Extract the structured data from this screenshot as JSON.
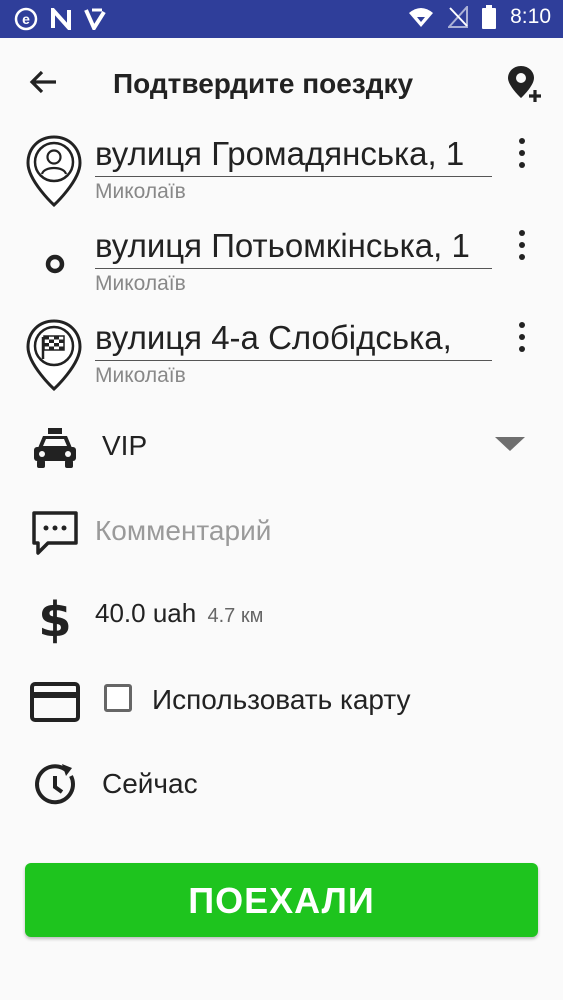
{
  "status_bar": {
    "time": "8:10"
  },
  "header": {
    "title": "Подтвердите поездку"
  },
  "route": [
    {
      "address": "вулиця Громадянська, 1",
      "city": "Миколаїв",
      "icon": "user-pin-icon"
    },
    {
      "address": "вулиця Потьомкінська, 1",
      "city": "Миколаїв",
      "icon": "waypoint-dot-icon"
    },
    {
      "address": "вулиця 4-а Слобідська,",
      "city": "Миколаїв",
      "icon": "finish-flag-pin-icon"
    }
  ],
  "tariff": {
    "value": "VIP"
  },
  "comment": {
    "placeholder": "Комментарий"
  },
  "price": {
    "amount": "40.0 uah",
    "distance": "4.7 км"
  },
  "payment": {
    "label": "Использовать карту",
    "checked": false
  },
  "time": {
    "label": "Сейчас"
  },
  "go_button": {
    "label": "ПОЕХАЛИ"
  },
  "colors": {
    "status_bar": "#2f3e9a",
    "go_button": "#1ec41e"
  }
}
